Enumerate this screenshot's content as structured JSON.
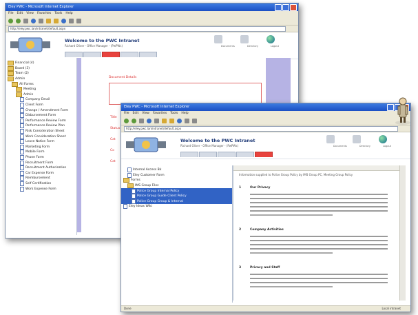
{
  "window_back": {
    "title": "Eley PWC - Microsoft Internet Explorer",
    "menu": [
      "File",
      "Edit",
      "View",
      "Favorites",
      "Tools",
      "Help"
    ],
    "address": "http://eley.pwc.lan/intranet/default.aspx",
    "banner_title": "Welcome to the PWC Intranet",
    "banner_sub": "Richard Oliver - Office Manager - (PwPWs)",
    "header_labels": [
      "Documents",
      "Directory",
      "Logout"
    ],
    "tree": [
      {
        "label": "Financial (4)",
        "kind": "folder",
        "indent": 0
      },
      {
        "label": "Board (3)",
        "kind": "folder",
        "indent": 0
      },
      {
        "label": "Team (2)",
        "kind": "folder",
        "indent": 0
      },
      {
        "label": "Admin",
        "kind": "folder",
        "indent": 0
      },
      {
        "label": "All Forms",
        "kind": "folder",
        "indent": 1
      },
      {
        "label": "Meeting",
        "kind": "folder",
        "indent": 2
      },
      {
        "label": "Admin",
        "kind": "folder",
        "indent": 2
      },
      {
        "label": "Company Email",
        "kind": "doc",
        "indent": 3
      },
      {
        "label": "Client Form",
        "kind": "doc",
        "indent": 3
      },
      {
        "label": "Change / Amendment Form",
        "kind": "doc",
        "indent": 3
      },
      {
        "label": "Disbursement Form",
        "kind": "doc",
        "indent": 3
      },
      {
        "label": "Performance Review Form",
        "kind": "doc",
        "indent": 3
      },
      {
        "label": "Performance Review Plan",
        "kind": "doc",
        "indent": 3
      },
      {
        "label": "Risk Consideration Sheet",
        "kind": "doc",
        "indent": 3
      },
      {
        "label": "Work Consideration Sheet",
        "kind": "doc",
        "indent": 3
      },
      {
        "label": "Leave Notice Form",
        "kind": "doc",
        "indent": 3
      },
      {
        "label": "Marketing Form",
        "kind": "doc",
        "indent": 3
      },
      {
        "label": "Mobile Form",
        "kind": "doc",
        "indent": 3
      },
      {
        "label": "Phone Form",
        "kind": "doc",
        "indent": 3
      },
      {
        "label": "Recruitment Form",
        "kind": "doc",
        "indent": 3
      },
      {
        "label": "Recruitment Authorisation",
        "kind": "doc",
        "indent": 3
      },
      {
        "label": "Car Expense Form",
        "kind": "doc",
        "indent": 3
      },
      {
        "label": "Reimbursement",
        "kind": "doc",
        "indent": 3
      },
      {
        "label": "Self Certification",
        "kind": "doc",
        "indent": 3
      },
      {
        "label": "Work Expense Form",
        "kind": "doc",
        "indent": 3
      }
    ],
    "form_labels": [
      "Document Details",
      "Title",
      "Status",
      "Cat",
      "Co",
      "Cat"
    ]
  },
  "window_front": {
    "title": "Eley PWC - Microsoft Internet Explorer",
    "menu": [
      "File",
      "Edit",
      "View",
      "Favorites",
      "Tools",
      "Help"
    ],
    "address": "http://eley.pwc.lan/intranet/default.aspx",
    "banner_title": "Welcome to the PWC Intranet",
    "banner_sub": "Richard Oliver - Office Manager - (PwPWs)",
    "header_labels": [
      "Documents",
      "Directory",
      "Logout"
    ],
    "tree": [
      {
        "label": "Internal Access Bk",
        "kind": "doc",
        "indent": 1
      },
      {
        "label": "Eley Customer Form",
        "kind": "doc",
        "indent": 1
      },
      {
        "label": "Forms",
        "kind": "folder",
        "indent": 0
      },
      {
        "label": "IMS Group Files",
        "kind": "folder",
        "indent": 1
      },
      {
        "label": "Police Group Internal Policy",
        "kind": "doc",
        "indent": 2,
        "selected": true
      },
      {
        "label": "Police Group Guide Client Policy",
        "kind": "doc",
        "indent": 2,
        "selected": true
      },
      {
        "label": "Police Group Group & Internal",
        "kind": "doc",
        "indent": 2,
        "selected": true
      },
      {
        "label": "Eley Ideas Wiki",
        "kind": "doc",
        "indent": 0
      }
    ],
    "doc_intro": "Information supplied to Police Group Policy by IMS Group PC, Meeting Group Policy",
    "doc_sections": [
      {
        "num": "1",
        "heading": "Our Privacy",
        "lines": 6
      },
      {
        "num": "2",
        "heading": "Company Activities",
        "lines": 5
      },
      {
        "num": "3",
        "heading": "Privacy and Staff",
        "lines": 4
      }
    ],
    "status_left": "Done",
    "status_right": "Local intranet"
  },
  "colors": {
    "accent_red": "#e8433e",
    "sidebar_purple": "#b6b3e4",
    "title_blue": "#1f3a77"
  }
}
